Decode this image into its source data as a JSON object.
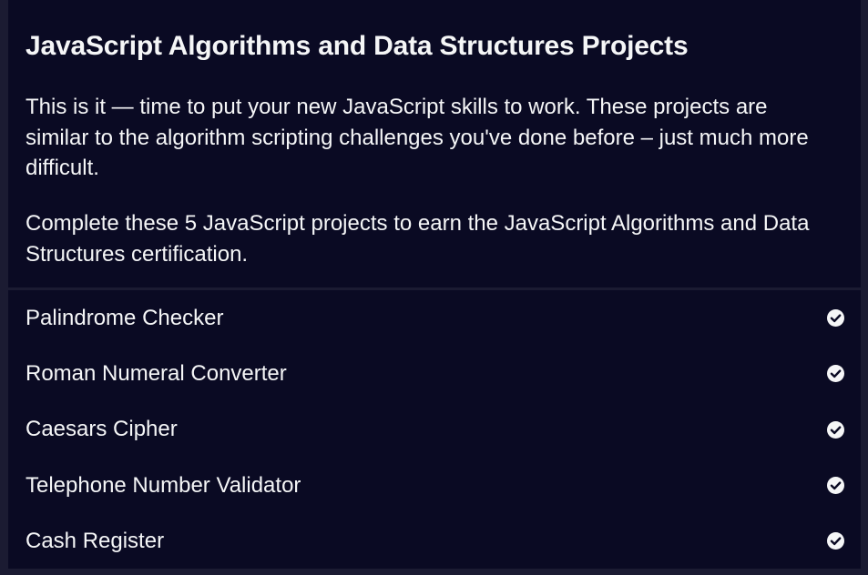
{
  "block": {
    "title": "JavaScript Algorithms and Data Structures Projects",
    "intro": [
      "This is it — time to put your new JavaScript skills to work. These projects are similar to the algorithm scripting challenges you've done before – just much more difficult.",
      "Complete these 5 JavaScript projects to earn the JavaScript Algorithms and Data Structures certification."
    ],
    "projects": [
      {
        "label": "Palindrome Checker",
        "icon": "check-circle-icon",
        "completed": true
      },
      {
        "label": "Roman Numeral Converter",
        "icon": "check-circle-icon",
        "completed": true
      },
      {
        "label": "Caesars Cipher",
        "icon": "check-circle-icon",
        "completed": true
      },
      {
        "label": "Telephone Number Validator",
        "icon": "check-circle-icon",
        "completed": true
      },
      {
        "label": "Cash Register",
        "icon": "check-circle-icon",
        "completed": true
      }
    ]
  },
  "colors": {
    "background": "#1b1b32",
    "panel": "#0a0a23",
    "text": "#f5f6f7"
  }
}
